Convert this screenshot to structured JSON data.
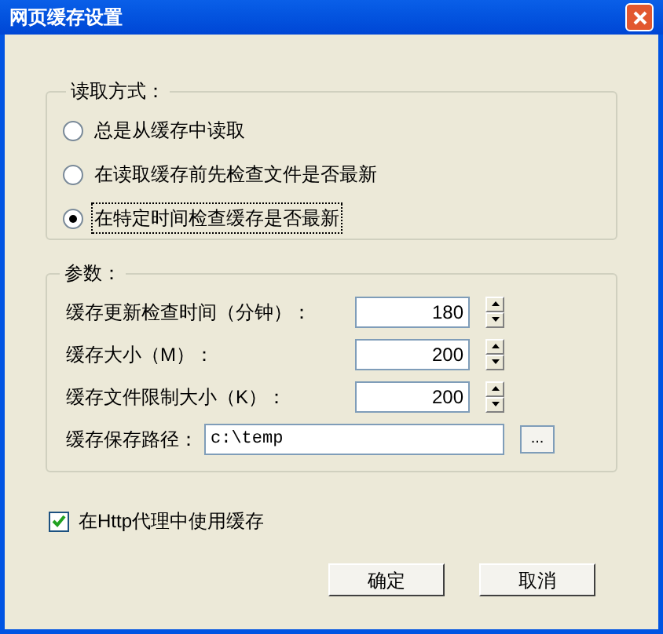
{
  "window": {
    "title": "网页缓存设置"
  },
  "read_mode": {
    "label": "读取方式：",
    "options": [
      {
        "label": "总是从缓存中读取",
        "selected": false
      },
      {
        "label": "在读取缓存前先检查文件是否最新",
        "selected": false
      },
      {
        "label": "在特定时间检查缓存是否最新",
        "selected": true
      }
    ]
  },
  "params": {
    "label": "参数：",
    "fields": [
      {
        "kind": "spin",
        "label": "缓存更新检查时间（分钟）：",
        "value": "180"
      },
      {
        "kind": "spin",
        "label": "缓存大小（M）：",
        "value": "200"
      },
      {
        "kind": "spin",
        "label": "缓存文件限制大小（K）：",
        "value": "200"
      },
      {
        "kind": "path",
        "label": "缓存保存路径：",
        "value": "c:\\temp",
        "browse": "..."
      }
    ]
  },
  "http_proxy": {
    "label": "在Http代理中使用缓存",
    "checked": true
  },
  "buttons": [
    "确定",
    "取消"
  ]
}
